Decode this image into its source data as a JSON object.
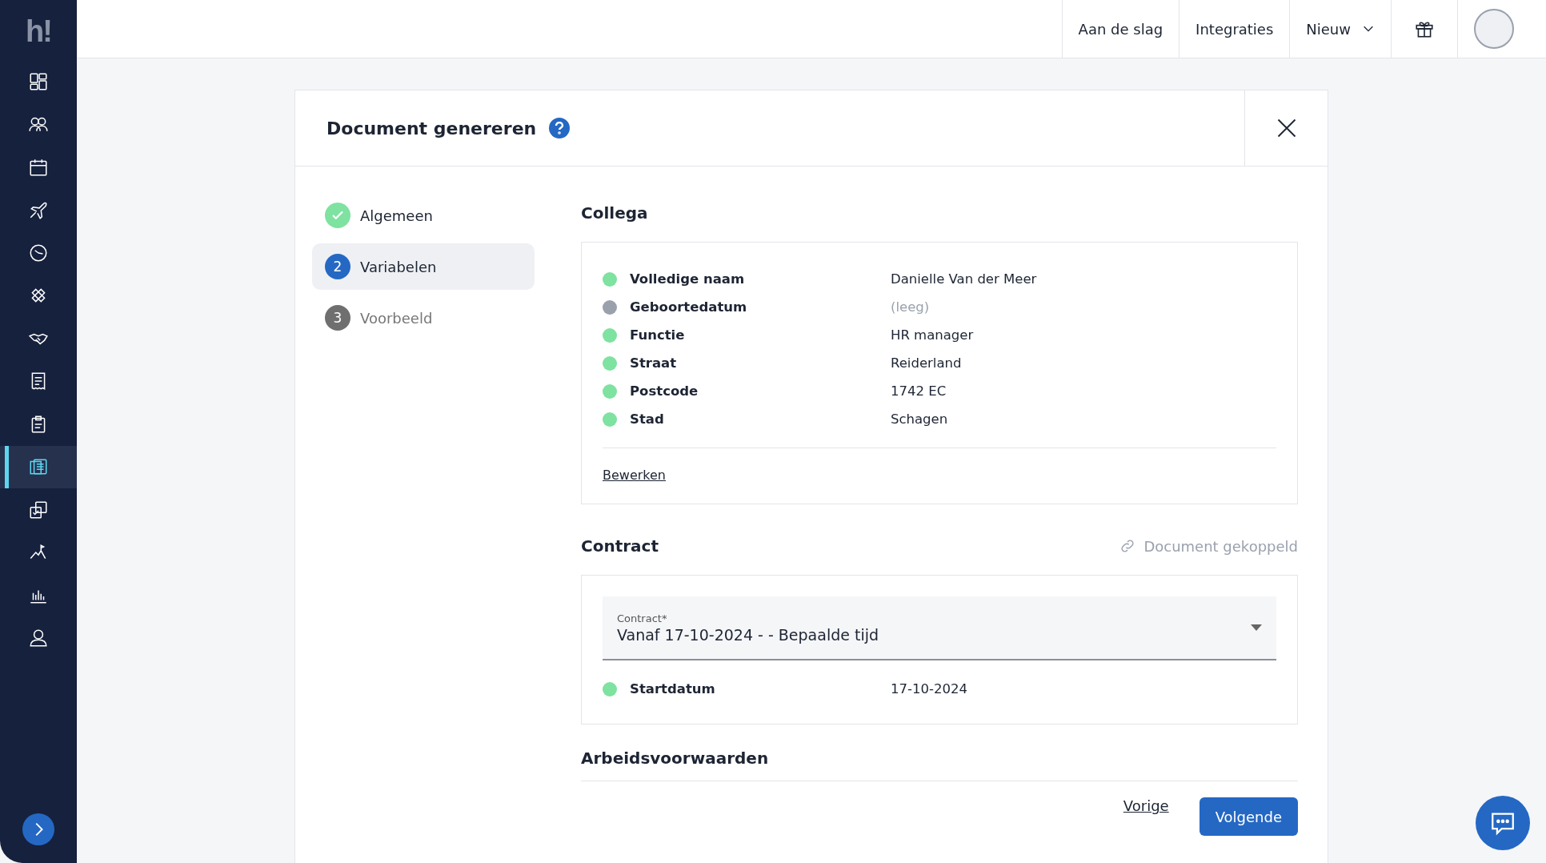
{
  "sidebar": {
    "logo": "h!",
    "items": [
      {
        "kind": "dashboard",
        "selected": false
      },
      {
        "kind": "people",
        "selected": false
      },
      {
        "kind": "calendar",
        "selected": false
      },
      {
        "kind": "plane",
        "selected": false
      },
      {
        "kind": "clock",
        "selected": false
      },
      {
        "kind": "bandage",
        "selected": false
      },
      {
        "kind": "handshake",
        "selected": false
      },
      {
        "kind": "receipt",
        "selected": false
      },
      {
        "kind": "clipboard",
        "selected": false
      },
      {
        "kind": "documents",
        "selected": true
      },
      {
        "kind": "checklist",
        "selected": false
      },
      {
        "kind": "mountain",
        "selected": false
      },
      {
        "kind": "chart",
        "selected": false
      },
      {
        "kind": "person",
        "selected": false
      }
    ]
  },
  "topbar": {
    "links": [
      "Aan de slag",
      "Integraties"
    ],
    "menu": "Nieuw"
  },
  "dialog": {
    "title": "Document genereren",
    "steps": [
      {
        "kind": "done",
        "label": "Algemeen",
        "selected": false
      },
      {
        "kind": "number",
        "number": "2",
        "label": "Variabelen",
        "selected": true
      },
      {
        "kind": "number",
        "number": "3",
        "label": "Voorbeeld",
        "selected": false
      }
    ],
    "collega": {
      "heading": "Collega",
      "fields": [
        {
          "label": "Volledige naam",
          "value": "Danielle Van der Meer",
          "filled": true
        },
        {
          "label": "Geboortedatum",
          "value": "(leeg)",
          "filled": false
        },
        {
          "label": "Functie",
          "value": "HR manager",
          "filled": true
        },
        {
          "label": "Straat",
          "value": "Reiderland",
          "filled": true
        },
        {
          "label": "Postcode",
          "value": "1742 EC",
          "filled": true
        },
        {
          "label": "Stad",
          "value": "Schagen",
          "filled": true
        }
      ],
      "edit_link": "Bewerken"
    },
    "contract": {
      "heading": "Contract",
      "linked": "Document gekoppeld",
      "select": {
        "label": "Contract*",
        "value": "Vanaf 17-10-2024 - - Bepaalde tijd"
      },
      "fields": [
        {
          "label": "Startdatum",
          "value": "17-10-2024",
          "filled": true
        }
      ]
    },
    "arbeid": {
      "heading": "Arbeidsvoorwaarden"
    },
    "buttons": {
      "back": "Vorige",
      "next": "Volgende"
    }
  }
}
